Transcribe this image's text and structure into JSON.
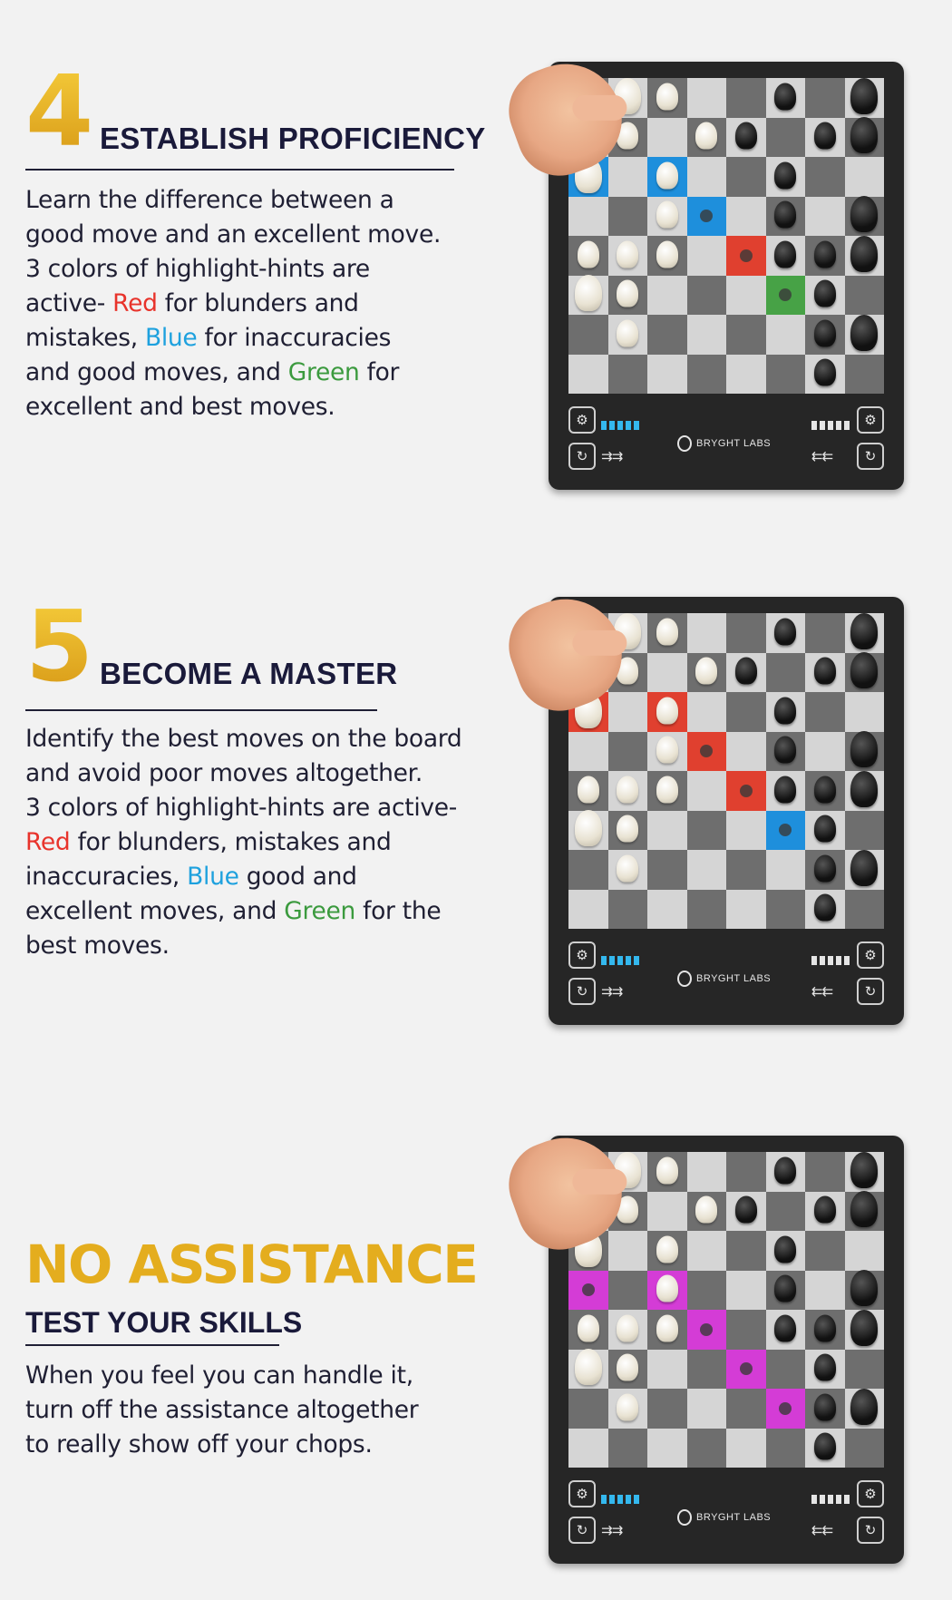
{
  "sections": [
    {
      "number": "4",
      "title": "ESTABLISH PROFICIENCY",
      "lines": {
        "l1": "Learn the difference between a",
        "l2": "good move and an excellent move.",
        "l3": "3 colors of highlight-hints are",
        "l4a": "active- ",
        "l4red": "Red",
        "l4b": " for blunders and",
        "l5a": "mistakes, ",
        "l5blue": "Blue",
        "l5b": " for inaccuracies",
        "l6a": "and good moves, and ",
        "l6green": "Green",
        "l6b": " for",
        "l7": "excellent and best moves."
      },
      "highlight_color": "#1e8fdc"
    },
    {
      "number": "5",
      "title": "BECOME A MASTER",
      "lines": {
        "l1": "Identify the best moves on the board",
        "l2": "and avoid poor moves altogether.",
        "l3": "3 colors of highlight-hints are active-",
        "l4red": "Red",
        "l4b": " for blunders, mistakes and",
        "l5a": "inaccuracies, ",
        "l5blue": "Blue",
        "l5b": " good and",
        "l6a": "excellent moves, and ",
        "l6green": "Green",
        "l6b": " for the",
        "l7": "best moves."
      },
      "highlight_color": "#e0402f"
    },
    {
      "title": "NO ASSISTANCE",
      "subtitle": "TEST YOUR SKILLS",
      "lines": {
        "l1": "When you feel you can handle it,",
        "l2": "turn off the assistance altogether",
        "l3": "to really show off your chops."
      },
      "highlight_color": "#d43cd6"
    }
  ],
  "board": {
    "brand": "BRYGHT LABS",
    "icons": [
      "settings-icon",
      "battery-icon",
      "undo-icon",
      "arrows-icon"
    ]
  },
  "colors": {
    "gold": "#e4ad1e",
    "red": "#e8332b",
    "blue": "#1ea1de",
    "green": "#3b9a3e",
    "magenta": "#d43cd6"
  }
}
